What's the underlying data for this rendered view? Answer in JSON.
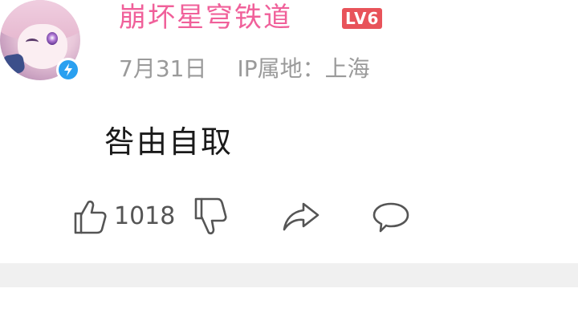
{
  "comment": {
    "user": {
      "name": "崩坏星穹铁道",
      "level": "LV6",
      "avatar_icon": "anime-character-avatar",
      "verified_icon": "lightning-badge-icon"
    },
    "date": "7月31日",
    "ip_location": "IP属地：上海",
    "text": "咎由自取",
    "actions": {
      "like_count": "1018"
    }
  },
  "colors": {
    "username": "#f0609a",
    "level_badge": "#e8535a",
    "verified_badge": "#2aa0f0",
    "meta_text": "#9a9a9a",
    "icon": "#555555",
    "divider": "#f0f0f0"
  }
}
